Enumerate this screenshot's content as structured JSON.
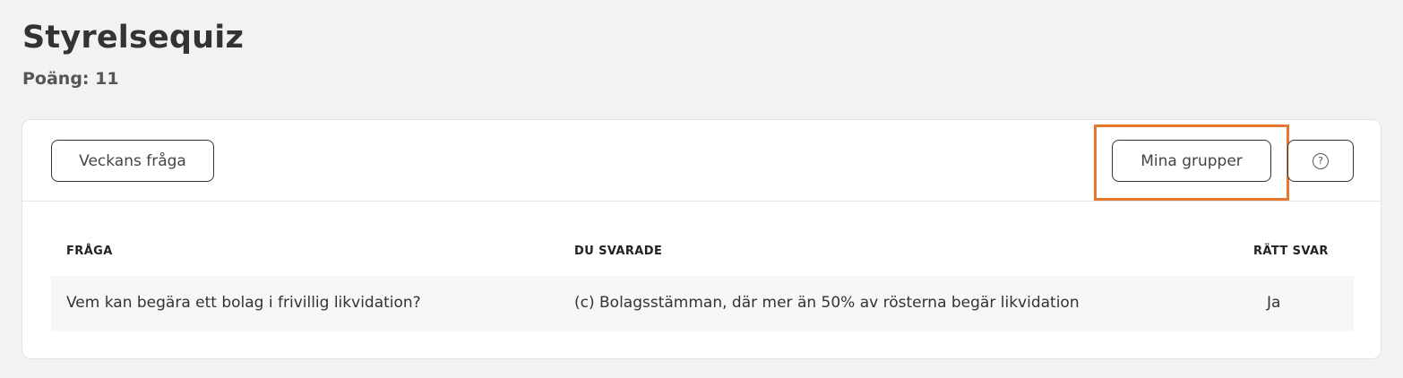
{
  "page": {
    "title": "Styrelsequiz",
    "score": "Poäng: 11"
  },
  "toolbar": {
    "weekly_question_label": "Veckans fråga",
    "my_groups_label": "Mina grupper",
    "help_icon": "question-circle-icon",
    "help_glyph": "?"
  },
  "table": {
    "headers": {
      "question": "FRÅGA",
      "answered": "DU SVARADE",
      "correct": "RÄTT SVAR"
    },
    "rows": [
      {
        "question": "Vem kan begära ett bolag i frivillig likvidation?",
        "answered": "(c) Bolagsstämman, där mer än 50% av rösterna begär likvidation",
        "correct": "Ja"
      }
    ]
  },
  "colors": {
    "background": "#f2f2f2",
    "card": "#ffffff",
    "highlight": "#e8772e",
    "row_background": "#f7f7f7",
    "text": "#333333"
  }
}
